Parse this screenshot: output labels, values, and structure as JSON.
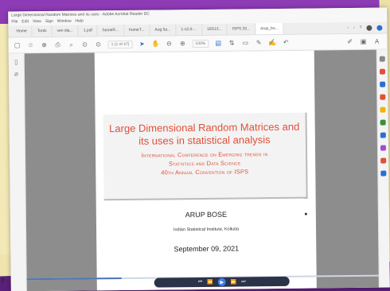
{
  "window": {
    "title": "Large Dimensional Random Matrices and its uses - Adobe Acrobat Reader DC",
    "menu": [
      "File",
      "Edit",
      "View",
      "Sign",
      "Window",
      "Help"
    ]
  },
  "tabs": [
    {
      "label": "Home"
    },
    {
      "label": "Tools"
    },
    {
      "label": "ven dia..."
    },
    {
      "label": "1.pdf"
    },
    {
      "label": "homeR..."
    },
    {
      "label": "homeT..."
    },
    {
      "label": "Aug 5a..."
    },
    {
      "label": "1-s2.0-..."
    },
    {
      "label": "18S13..."
    },
    {
      "label": "ISPS 20..."
    },
    {
      "label": "arup_bo..."
    }
  ],
  "toolbar": {
    "page_indicator": "1 (1 of 47)",
    "zoom": "100%"
  },
  "slide": {
    "title": "Large Dimensional Random Matrices and its uses in statistical analysis",
    "subtitle_line1": "International Conference on Emerging trends in",
    "subtitle_line2": "Statistics and Data Science",
    "subtitle_line3": "40th Annual Convention of ISPS",
    "author": "ARUP BOSE",
    "affiliation": "Indian Statistical Institute, Kolkata",
    "date": "September 09, 2021"
  },
  "player": {
    "progress": 0.27
  },
  "colors": {
    "accent": "#e0503a",
    "frame": "#8d3cb5",
    "cream": "#f1e7b0",
    "player": "#2a3347",
    "play": "#3f7ee8"
  },
  "stray_char": "r"
}
